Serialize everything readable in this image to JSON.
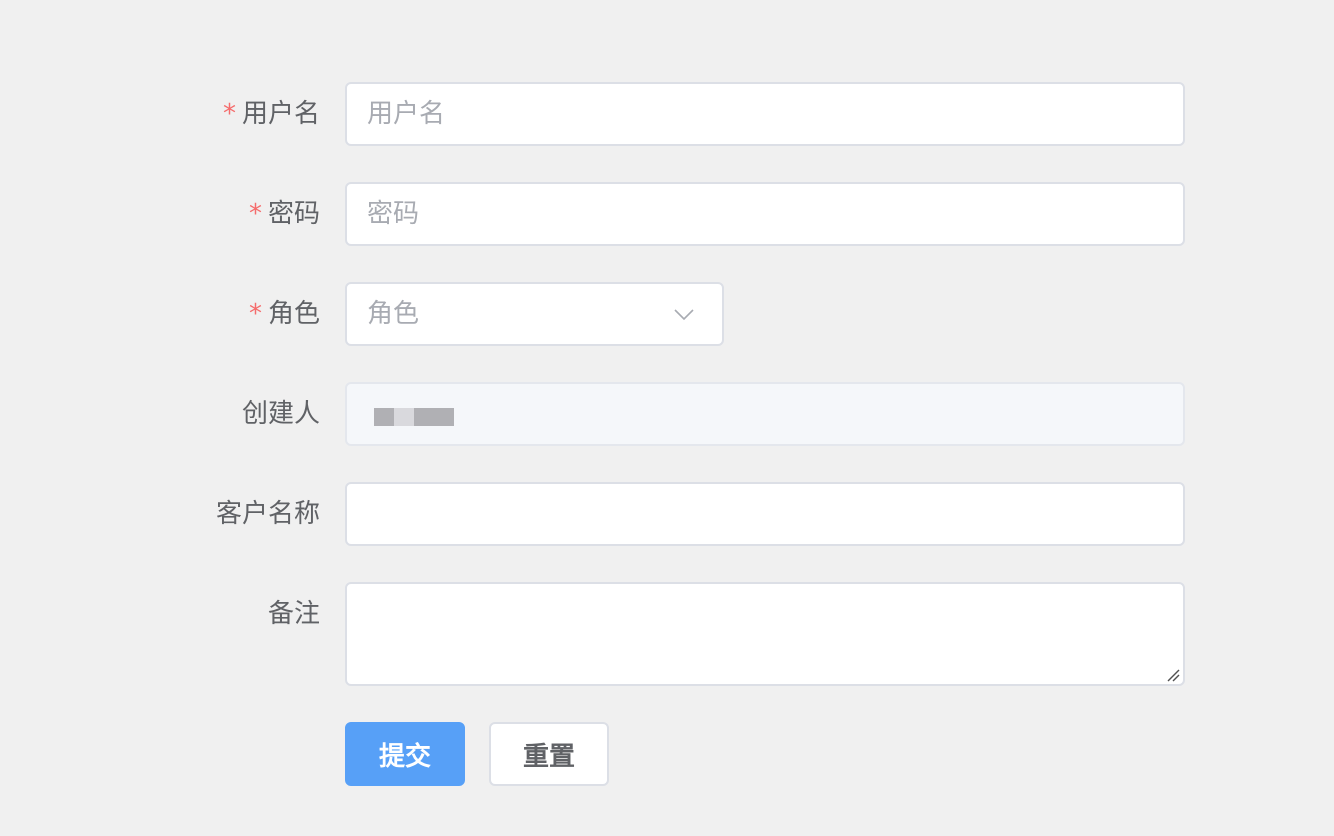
{
  "form": {
    "username": {
      "label": "用户名",
      "required": "*",
      "placeholder": "用户名",
      "value": ""
    },
    "password": {
      "label": "密码",
      "required": "*",
      "placeholder": "密码",
      "value": ""
    },
    "role": {
      "label": "角色",
      "required": "*",
      "placeholder": "角色"
    },
    "creator": {
      "label": "创建人"
    },
    "customer_name": {
      "label": "客户名称",
      "value": ""
    },
    "remark": {
      "label": "备注",
      "value": ""
    }
  },
  "actions": {
    "submit_label": "提交",
    "reset_label": "重置"
  },
  "colors": {
    "background": "#f0f0f0",
    "primary": "#57a0f7",
    "required": "#f56c6c",
    "label_text": "#606266",
    "placeholder": "#a8abb2",
    "border": "#dcdfe6",
    "disabled_bg": "#f5f7fa"
  },
  "icons": {
    "role_select": "chevron-down-icon",
    "remark_resize": "resize-grip-icon"
  }
}
